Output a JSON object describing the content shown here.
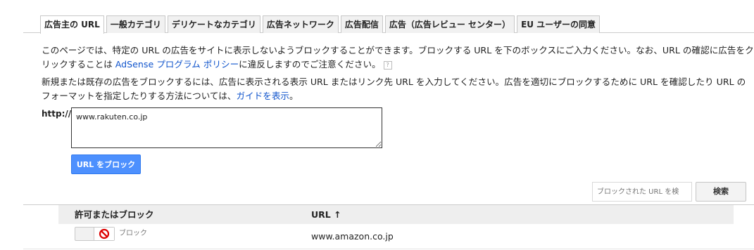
{
  "tabs": [
    {
      "label": "広告主の URL",
      "active": true
    },
    {
      "label": "一般カテゴリ"
    },
    {
      "label": "デリケートなカテゴリ"
    },
    {
      "label": "広告ネットワーク"
    },
    {
      "label": "広告配信"
    },
    {
      "label": "広告（広告レビュー センター）"
    },
    {
      "label": "EU ユーザーの同意"
    }
  ],
  "intro": {
    "text_before_link": "このページでは、特定の URL の広告をサイトに表示しないようブロックすることができます。ブロックする URL を下のボックスにご入力ください。なお、URL の確認に広告をクリックすることは ",
    "policy_link": "AdSense プログラム ポリシー",
    "text_after_link": "に違反しますのでご注意ください。",
    "help_icon_text": "?"
  },
  "instructions": {
    "text_before_link": "新規または既存の広告をブロックするには、広告に表示される表示 URL またはリンク先 URL を入力してください。広告を適切にブロックするために URL を確認したり URL のフォーマットを指定したりする方法については、",
    "guide_link": "ガイドを表示",
    "text_after_link": "。"
  },
  "url_form": {
    "prefix_label": "http://",
    "value": "www.rakuten.co.jp",
    "block_button": "URL をブロック"
  },
  "search": {
    "placeholder": "ブロックされた URL を検",
    "button": "検索"
  },
  "table": {
    "headers": {
      "status": "許可またはブロック",
      "url": "URL ↑"
    },
    "rows": [
      {
        "status": "ブロック",
        "url": "www.amazon.co.jp"
      }
    ]
  },
  "colors": {
    "accent": "#4d90fe",
    "link": "#1155cc",
    "block_red": "#dd0000"
  }
}
